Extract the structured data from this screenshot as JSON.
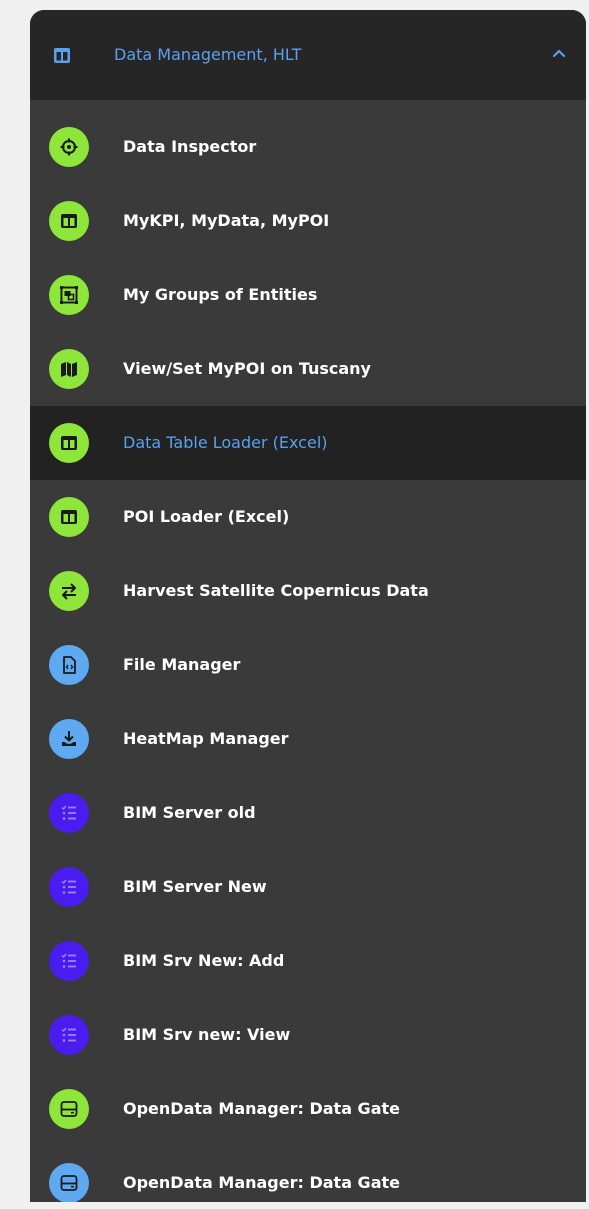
{
  "header": {
    "title": "Data Management, HLT",
    "icon": "table-icon",
    "chevron": "chevron-up-icon",
    "color": "#5aa0ec"
  },
  "colors": {
    "green": "#8ee63a",
    "blue": "#5fa8f2",
    "purple": "#4a1cf0",
    "panel": "#3a3a3a",
    "header": "#262626",
    "active": "#222222"
  },
  "items": [
    {
      "label": "Data Inspector",
      "icon": "crosshair-icon",
      "color": "green",
      "active": false
    },
    {
      "label": "MyKPI, MyData, MyPOI",
      "icon": "table-icon",
      "color": "green",
      "active": false
    },
    {
      "label": "My Groups of Entities",
      "icon": "group-icon",
      "color": "green",
      "active": false
    },
    {
      "label": "View/Set MyPOI on Tuscany",
      "icon": "map-icon",
      "color": "green",
      "active": false
    },
    {
      "label": "Data Table Loader (Excel)",
      "icon": "table-icon",
      "color": "green",
      "active": true
    },
    {
      "label": "POI Loader (Excel)",
      "icon": "table-icon",
      "color": "green",
      "active": false
    },
    {
      "label": "Harvest Satellite Copernicus Data",
      "icon": "swap-icon",
      "color": "green",
      "active": false
    },
    {
      "label": "File Manager",
      "icon": "code-file-icon",
      "color": "blue",
      "active": false
    },
    {
      "label": "HeatMap Manager",
      "icon": "download-icon",
      "color": "blue",
      "active": false
    },
    {
      "label": "BIM Server old",
      "icon": "checklist-icon",
      "color": "purple",
      "active": false
    },
    {
      "label": "BIM Server New",
      "icon": "checklist-icon",
      "color": "purple",
      "active": false
    },
    {
      "label": "BIM Srv New: Add",
      "icon": "checklist-icon",
      "color": "purple",
      "active": false
    },
    {
      "label": "BIM Srv new: View",
      "icon": "checklist-icon",
      "color": "purple",
      "active": false
    },
    {
      "label": "OpenData Manager: Data Gate",
      "icon": "server-icon",
      "color": "green",
      "active": false
    },
    {
      "label": "OpenData Manager: Data Gate",
      "icon": "server-icon",
      "color": "blue",
      "active": false
    }
  ]
}
